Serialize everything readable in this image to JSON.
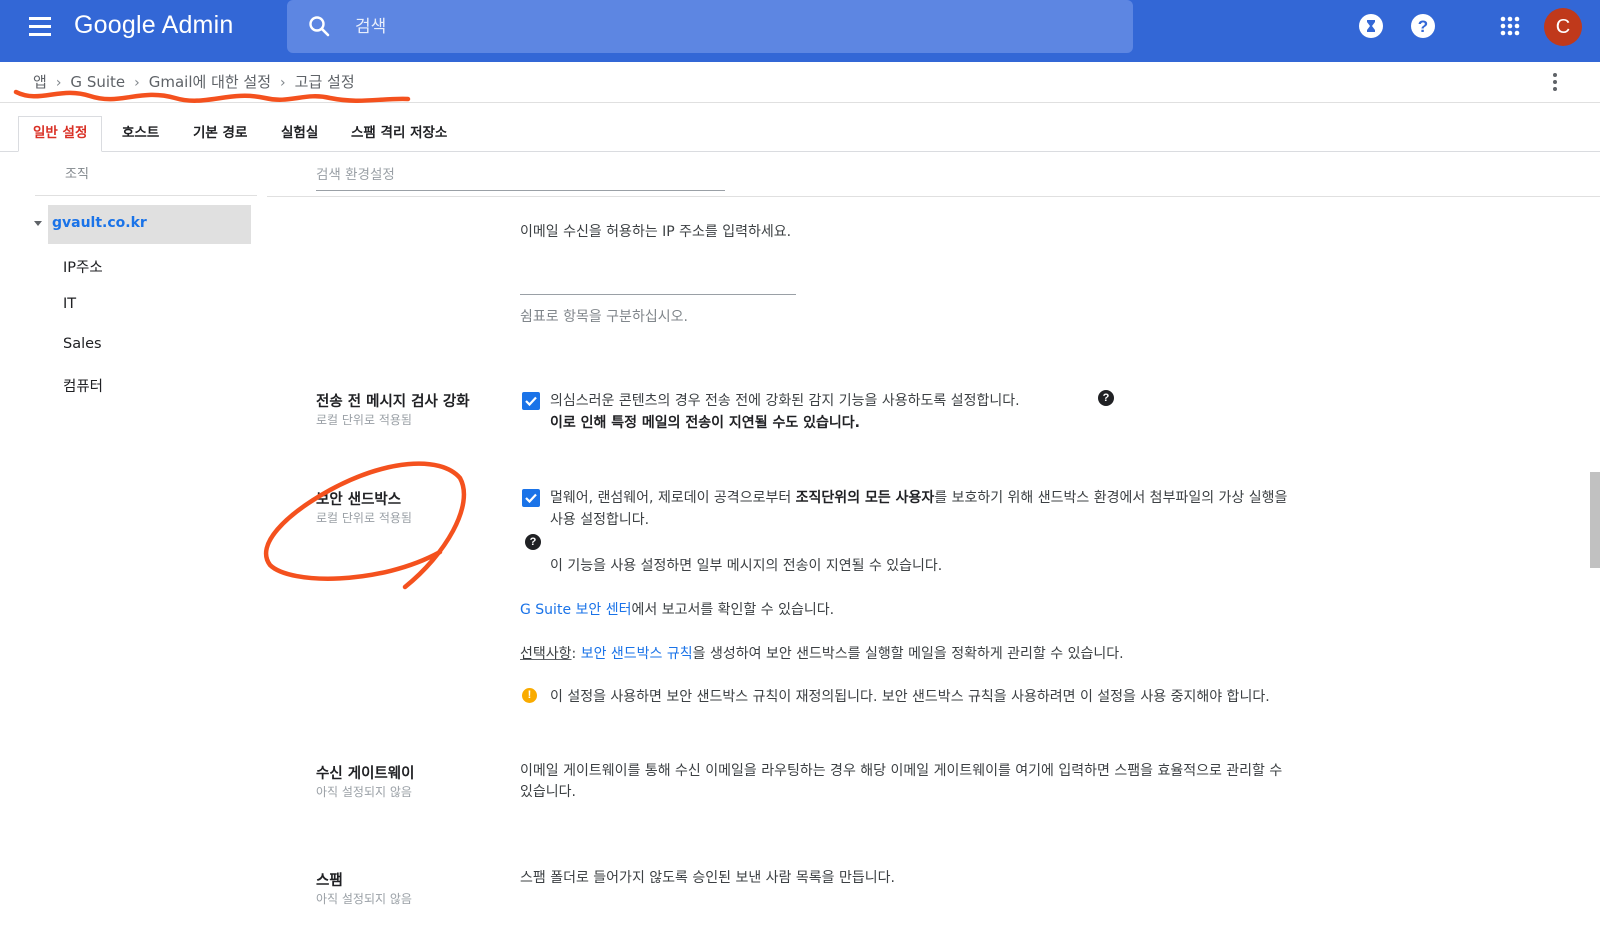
{
  "header": {
    "app_title": "Google Admin",
    "search_placeholder": "검색",
    "avatar_initial": "C",
    "colors": {
      "bar": "#3367d6",
      "search": "#5d86e2",
      "avatar": "#c0391b"
    }
  },
  "breadcrumb": {
    "items": [
      "앱",
      "G Suite",
      "Gmail에 대한 설정",
      "고급 설정"
    ]
  },
  "tabs": [
    {
      "label": "일반 설정",
      "active": true
    },
    {
      "label": "호스트",
      "active": false
    },
    {
      "label": "기본 경로",
      "active": false
    },
    {
      "label": "실험실",
      "active": false
    },
    {
      "label": "스팸 격리 저장소",
      "active": false
    }
  ],
  "sidebar": {
    "heading": "조직",
    "root": "gvault.co.kr",
    "children": [
      "IP주소",
      "IT",
      "Sales",
      "컴퓨터"
    ]
  },
  "filter": {
    "placeholder": "검색 환경설정"
  },
  "settings": {
    "ip": {
      "description": "이메일 수신을 허용하는 IP 주소를 입력하세요.",
      "input_value": "",
      "hint": "쉼표로 항목을 구분하십시오."
    },
    "prescan": {
      "title": "전송 전 메시지 검사 강화",
      "scope": "로컬 단위로 적용됨",
      "checked": true,
      "text": "의심스러운 콘텐츠의 경우 전송 전에 강화된 감지 기능을 사용하도록 설정합니다.",
      "bold_text": "이로 인해 특정 메일의 전송이 지연될 수도 있습니다."
    },
    "sandbox": {
      "title": "보안 샌드박스",
      "scope": "로컬 단위로 적용됨",
      "checked": true,
      "text_a": "멀웨어, 랜섬웨어, 제로데이 공격으로부터 ",
      "text_bold": "조직단위의 모든 사용자",
      "text_b": "를 보호하기 위해 샌드박스 환경에서 첨부파일의 가상 실행을",
      "text_line2": "사용 설정합니다.",
      "delay_note": "이 기능을 사용 설정하면 일부 메시지의 전송이 지연될 수 있습니다.",
      "report_link": "G Suite 보안 센터",
      "report_text": "에서 보고서를 확인할 수 있습니다.",
      "optional_label": "선택사항",
      "optional_sep": ": ",
      "rules_link": "보안 샌드박스 규칙",
      "rules_text": "을 생성하여 보안 샌드박스를 실행할 메일을 정확하게 관리할 수 있습니다.",
      "warning": "이 설정을 사용하면 보안 샌드박스 규칙이 재정의됩니다. 보안 샌드박스 규칙을 사용하려면 이 설정을 사용 중지해야 합니다."
    },
    "gateway": {
      "title": "수신 게이트웨이",
      "status": "아직 설정되지 않음",
      "text_line1": "이메일 게이트웨이를 통해 수신 이메일을 라우팅하는 경우 해당 이메일 게이트웨이를 여기에 입력하면 스팸을 효율적으로 관리할 수",
      "text_line2": "있습니다."
    },
    "spam": {
      "title": "스팸",
      "status": "아직 설정되지 않음",
      "text": "스팸 폴더로 들어가지 않도록 승인된 보낸 사람 목록을 만듭니다."
    }
  },
  "annotation_color": "#f4511e"
}
